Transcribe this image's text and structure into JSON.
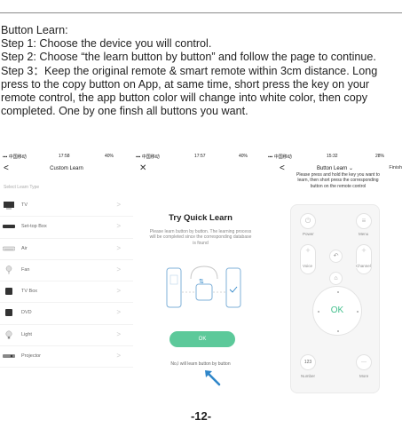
{
  "instructions": {
    "heading": "Button Learn:",
    "step1": "Step 1: Choose the device you will control.",
    "step2": "Step 2:  Choose “the learn button by button” and follow the page to continue.",
    "step3": "Step 3：Keep the original remote & smart remote within 3cm distance. Long press to the copy button on App, at same time, short press the key on your remote control, the app button color will change into white color, then copy completed. One by one finsh all buttons you want."
  },
  "phone1": {
    "status": {
      "carrier": "中国移动",
      "time": "17:58",
      "battery": "40%"
    },
    "back_glyph": "<",
    "title": "Custom Learn",
    "subtitle": "Select Learn Type",
    "chevron": ">",
    "devices": [
      {
        "label": "TV",
        "icon": "tv-icon"
      },
      {
        "label": "Set-top Box",
        "icon": "set-top-box-icon"
      },
      {
        "label": "Air",
        "icon": "air-conditioner-icon"
      },
      {
        "label": "Fan",
        "icon": "fan-icon"
      },
      {
        "label": "TV Box",
        "icon": "tv-box-icon"
      },
      {
        "label": "DVD",
        "icon": "dvd-icon"
      },
      {
        "label": "Light",
        "icon": "light-bulb-icon"
      },
      {
        "label": "Projector",
        "icon": "projector-icon"
      }
    ]
  },
  "phone2": {
    "status": {
      "carrier": "中国移动",
      "time": "17:57",
      "battery": "40%"
    },
    "close_glyph": "✕",
    "heading": "Try Quick Learn",
    "description": "Please learn button by button. The learning process will be completed since the corresponding database is found",
    "ok_label": "OK",
    "alt_link": "No,I will learn button by button",
    "colors": {
      "accent": "#5cc99a",
      "arrow": "#2f86c9"
    }
  },
  "phone3": {
    "status": {
      "carrier": "中国移动",
      "time": "15:32",
      "battery": "28%"
    },
    "back_glyph": "<",
    "title": "Button Learn ⌄",
    "finish_label": "Finish",
    "hint": "Please press and hold the key you want to learn, then short press the corresponding button on the remote control",
    "remote": {
      "power_label": "Power",
      "menu_label": "Menu",
      "voice_label": "Voice",
      "channel_label": "Channel",
      "ok_label": "OK",
      "number_button": "123",
      "number_label": "Number",
      "more_button": "···",
      "more_label": "More",
      "plus": "+",
      "minus": "−"
    }
  },
  "page_number": "-12-"
}
